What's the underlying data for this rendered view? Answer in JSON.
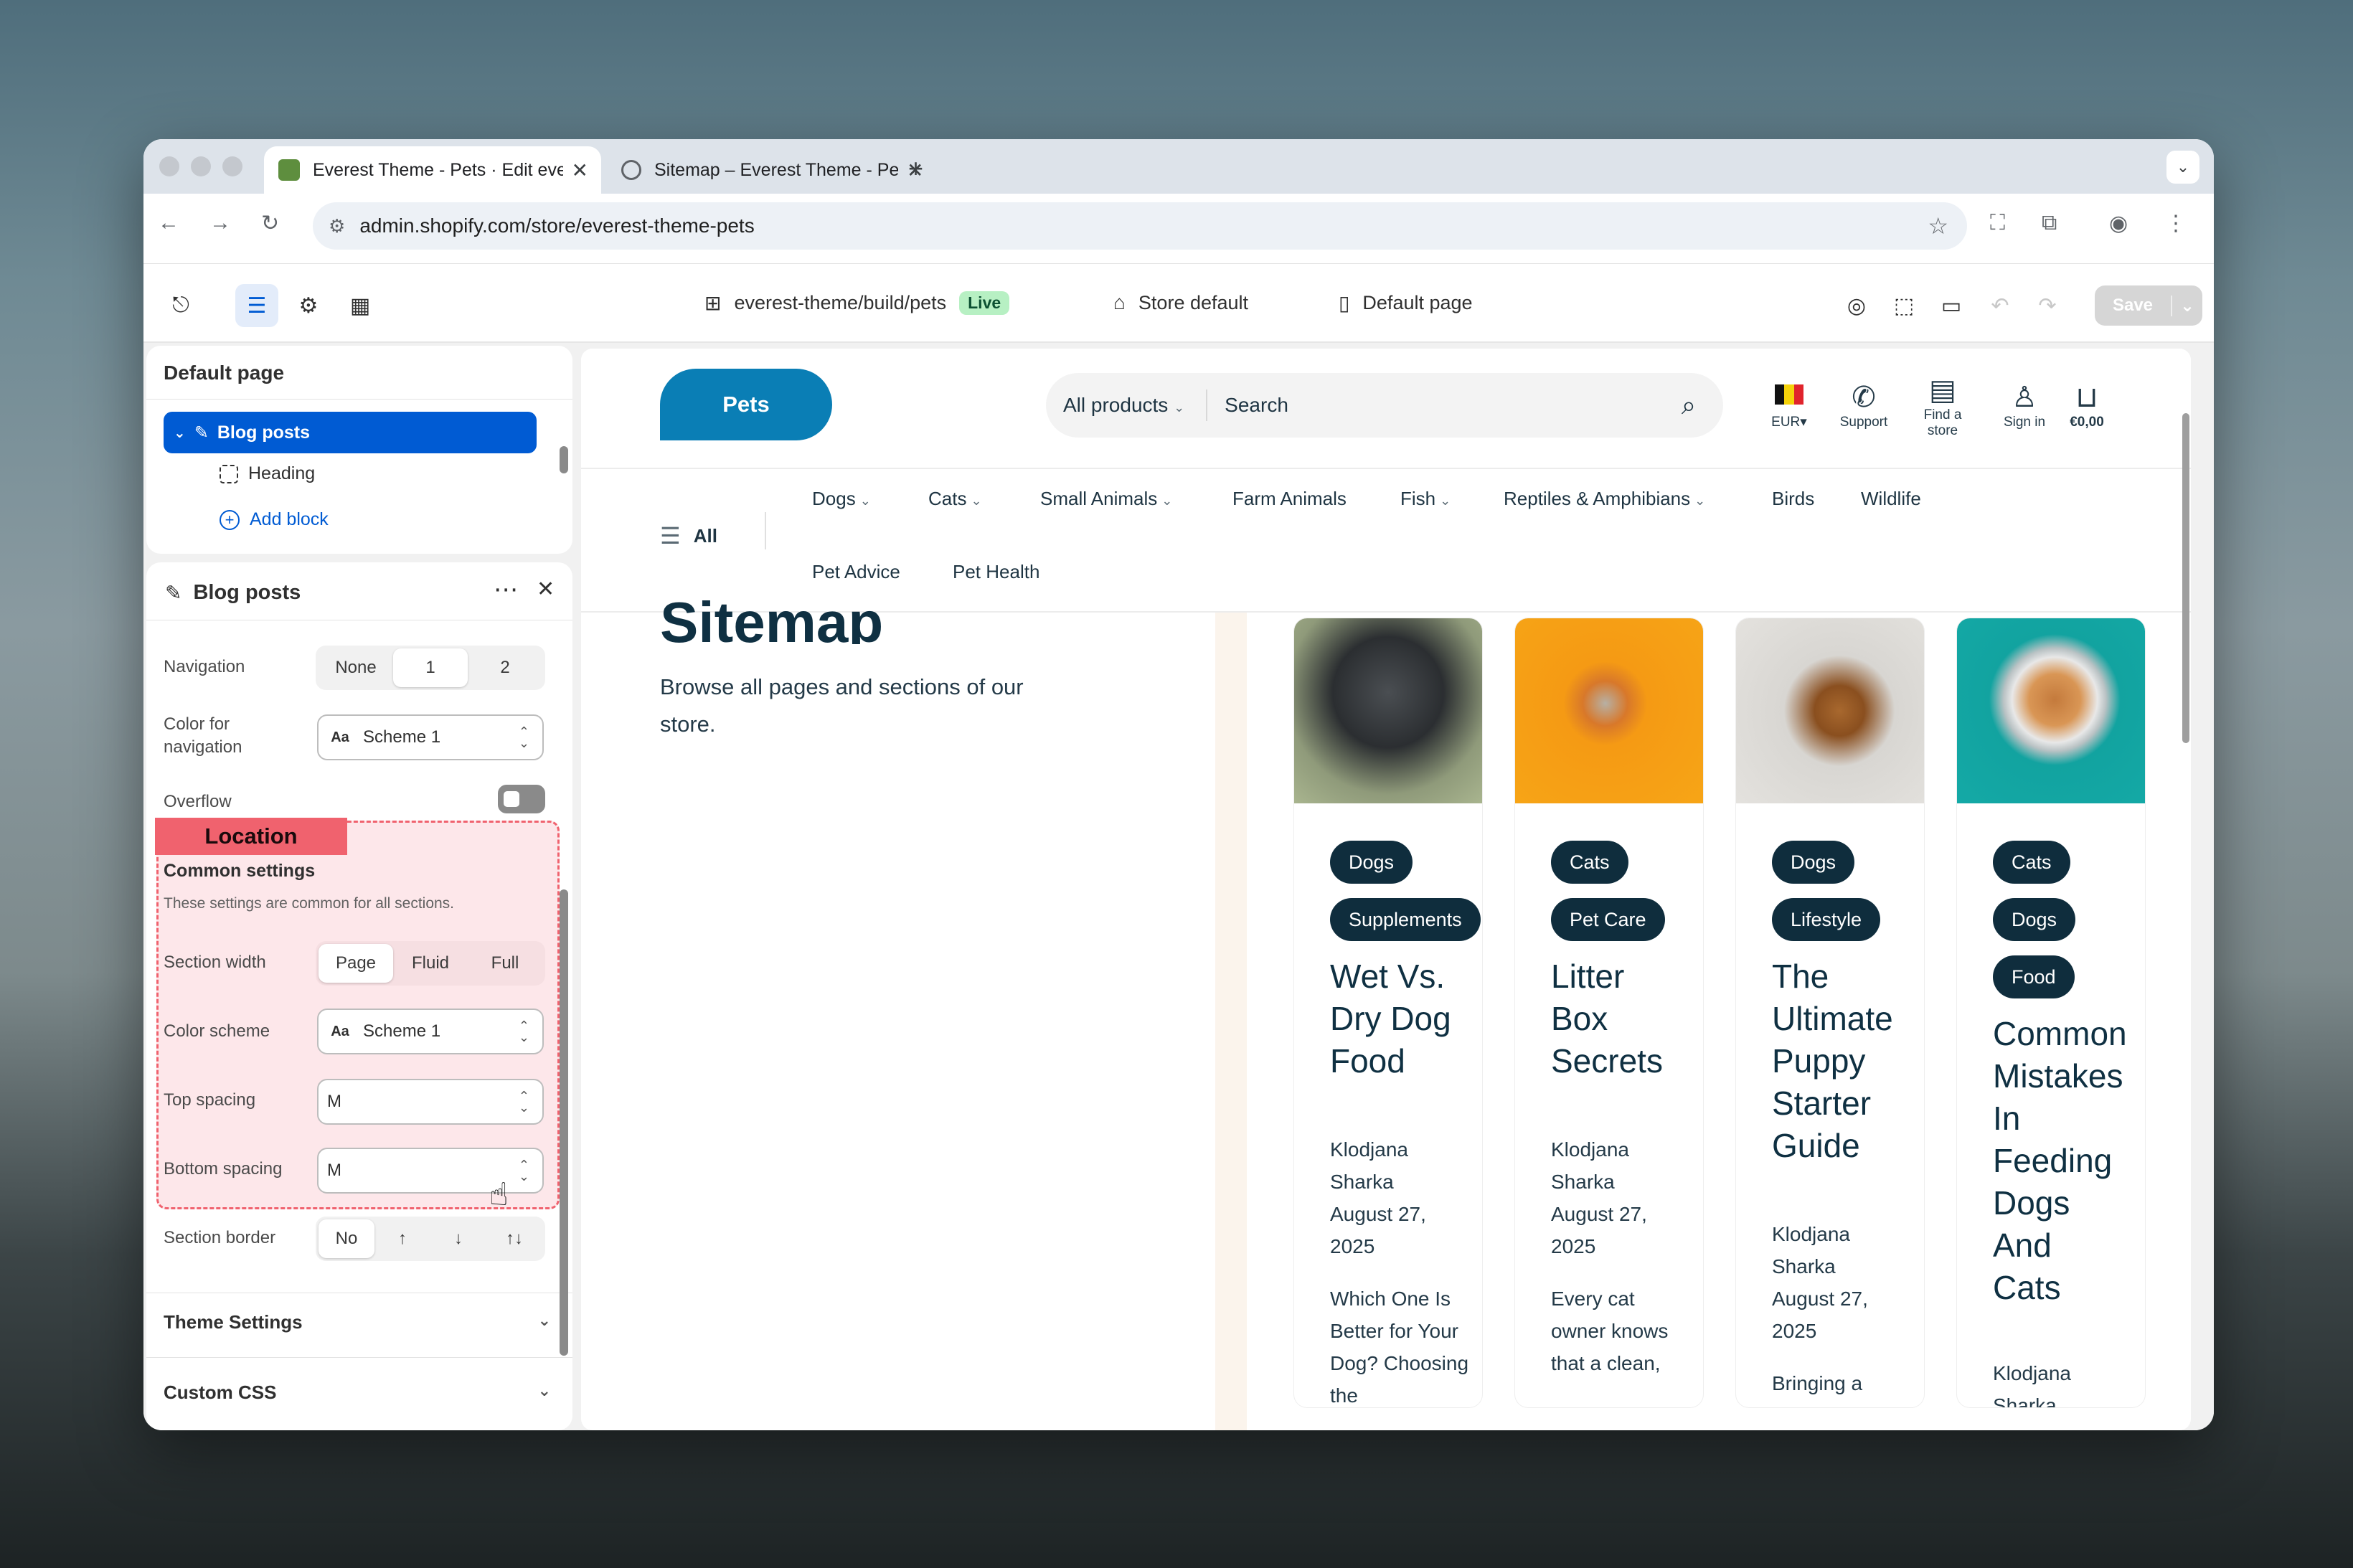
{
  "browser": {
    "tabs": [
      {
        "title": "Everest Theme - Pets · Edit everest-theme/build/pets"
      },
      {
        "title": "Sitemap – Everest Theme - Pets"
      }
    ],
    "new_tab": "+",
    "url_host": "admin.shopify.com",
    "url_path": "/store/everest-theme-pets"
  },
  "editor": {
    "theme_path": "everest-theme/build/pets",
    "live_badge": "Live",
    "store_default": "Store default",
    "page_select": "Default page",
    "save_label": "Save"
  },
  "tree": {
    "title": "Default page",
    "selected": "Blog posts",
    "child": "Heading",
    "add_block": "Add block"
  },
  "panel": {
    "title": "Blog posts",
    "navigation_label": "Navigation",
    "navigation_options": [
      "None",
      "1",
      "2"
    ],
    "color_nav_label": "Color for navigation",
    "color_nav_value": "Scheme 1",
    "overflow_label": "Overflow",
    "location_tag": "Location",
    "common_title": "Common settings",
    "common_desc": "These settings are common for all sections.",
    "section_width_label": "Section width",
    "section_width_options": [
      "Page",
      "Fluid",
      "Full"
    ],
    "color_scheme_label": "Color scheme",
    "color_scheme_value": "Scheme 1",
    "top_spacing_label": "Top spacing",
    "top_spacing_value": "M",
    "bottom_spacing_label": "Bottom spacing",
    "bottom_spacing_value": "M",
    "section_border_label": "Section border",
    "section_border_options": [
      "No",
      "↑",
      "↓",
      "↑↓"
    ],
    "theme_settings": "Theme Settings",
    "custom_css": "Custom CSS",
    "scheme_icon_text": "Aa"
  },
  "store": {
    "logo": "Pets",
    "all_products": "All products",
    "search_placeholder": "Search",
    "currency": "EUR",
    "support": "Support",
    "find_store": "Find a store",
    "sign_in": "Sign in",
    "cart": "€0,00",
    "all": "All",
    "nav": [
      "Dogs",
      "Cats",
      "Small Animals",
      "Farm Animals",
      "Fish",
      "Reptiles & Amphibians",
      "Birds",
      "Wildlife",
      "Pet Advice",
      "Pet Health"
    ],
    "page_title": "Sitemap",
    "page_desc": "Browse all pages and sections of our store."
  },
  "blog_cards": [
    {
      "tags": [
        "Dogs",
        "Supplements"
      ],
      "title": "Wet Vs. Dry Dog Food",
      "author": "Klodjana Sharka",
      "date": "August 27, 2025",
      "excerpt": "Which One Is Better for Your Dog? Choosing the"
    },
    {
      "tags": [
        "Cats",
        "Pet Care"
      ],
      "title": "Litter Box Secrets",
      "author": "Klodjana Sharka",
      "date": "August 27, 2025",
      "excerpt": "Every cat owner knows that a clean,"
    },
    {
      "tags": [
        "Dogs",
        "Lifestyle"
      ],
      "title": "The Ultimate Puppy Starter Guide",
      "author": "Klodjana Sharka",
      "date": "August 27, 2025",
      "excerpt": "Bringing a puppy into"
    },
    {
      "tags": [
        "Cats",
        "Dogs",
        "Food"
      ],
      "title": "Common Mistakes In Feeding Dogs And Cats",
      "author": "Klodjana Sharka",
      "date": "",
      "excerpt": ""
    }
  ],
  "colors": {
    "accent": "#005bd3",
    "store_primary": "#0a7eb5",
    "pill_dark": "#0f2d3d",
    "location_red": "#f0626e"
  }
}
